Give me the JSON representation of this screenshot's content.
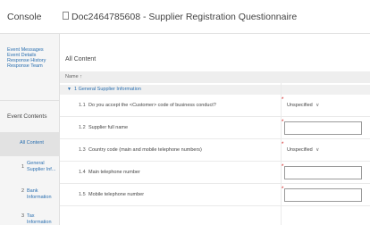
{
  "header": {
    "console": "Console",
    "doc_title": "Doc2464785608 - Supplier Registration Questionnaire"
  },
  "sidebar": {
    "links": [
      "Event Messages",
      "Event Details",
      "Response History",
      "Response Team"
    ],
    "section": "Event Contents",
    "active": "All Content",
    "items": [
      {
        "num": "1",
        "label": "General Supplier Inf..."
      },
      {
        "num": "2",
        "label": "Bank Information"
      },
      {
        "num": "3",
        "label": "Tax Information"
      }
    ]
  },
  "main": {
    "heading": "All Content",
    "name_header": "Name ↑",
    "section": {
      "chevron": "▼",
      "label": "1  General Supplier Information"
    },
    "rows": [
      {
        "num": "1.1",
        "text": "Do you accept the <Customer> code of business conduct?",
        "required": "*",
        "control": "select",
        "value": "Unspecified",
        "arrow": "∨"
      },
      {
        "num": "1.2",
        "text": "Supplier full name",
        "required": "*",
        "control": "input",
        "value": ""
      },
      {
        "num": "1.3",
        "text": "Country code (main and mobile telephone numbers)",
        "required": "*",
        "control": "select",
        "value": "Unspecified",
        "arrow": "∨"
      },
      {
        "num": "1.4",
        "text": "Main telephone number",
        "required": "*",
        "control": "input",
        "value": ""
      },
      {
        "num": "1.5",
        "text": "Mobile telephone number",
        "required": "*",
        "control": "input",
        "value": ""
      }
    ]
  }
}
